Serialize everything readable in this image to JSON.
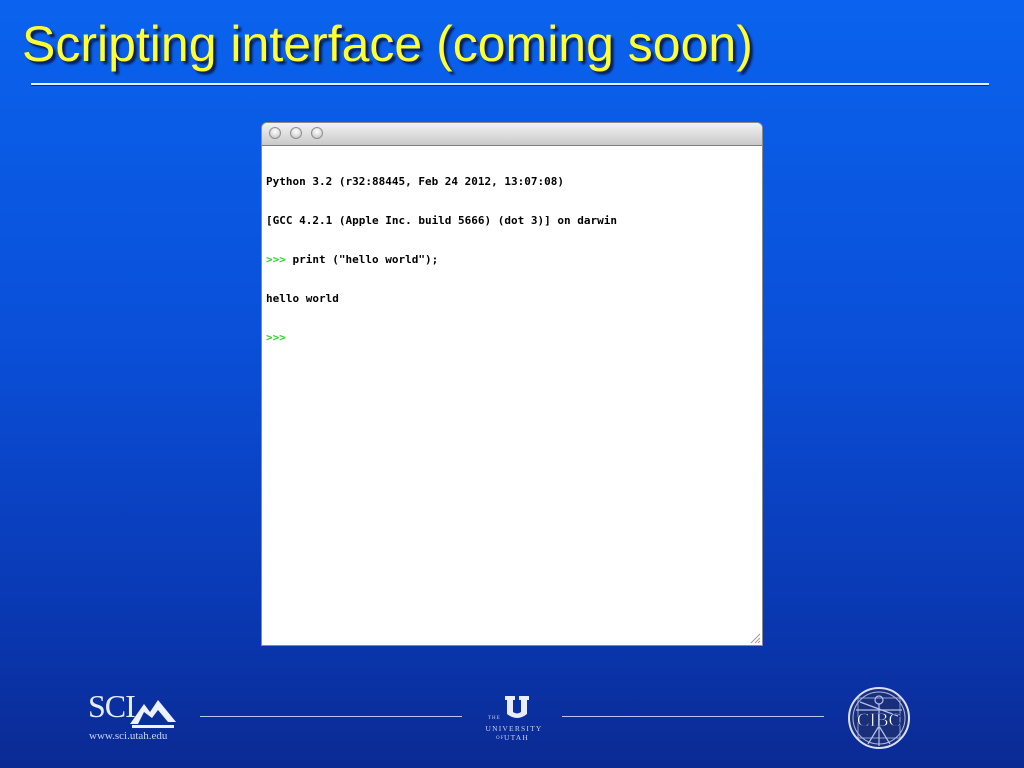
{
  "slide": {
    "title": "Scripting interface (coming soon)"
  },
  "terminal": {
    "lines": [
      {
        "prompt": "",
        "text": "Python 3.2 (r32:88445, Feb 24 2012, 13:07:08)"
      },
      {
        "prompt": "",
        "text": "[GCC 4.2.1 (Apple Inc. build 5666) (dot 3)] on darwin"
      },
      {
        "prompt": ">>>",
        "text": " print (\"hello world\");"
      },
      {
        "prompt": "",
        "text": "hello world"
      },
      {
        "prompt": ">>>",
        "text": ""
      }
    ],
    "window_controls": [
      "close-icon",
      "minimize-icon",
      "zoom-icon"
    ]
  },
  "footer": {
    "sci": {
      "logo_text": "SCI",
      "url": "www.sci.utah.edu"
    },
    "university": {
      "the": "THE",
      "name": "UNIVERSITY",
      "of": "OF",
      "state": "UTAH"
    },
    "cibc": {
      "logo_text": "CIBC"
    }
  },
  "colors": {
    "title": "#ffff33",
    "prompt": "#2fd12f",
    "background_top": "#0a63ee",
    "background_bottom": "#0b2a93"
  }
}
